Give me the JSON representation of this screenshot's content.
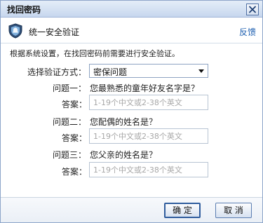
{
  "dialog": {
    "title": "找回密码",
    "close_icon": "close-icon"
  },
  "header": {
    "icon": "shield-icon",
    "title": "统一安全验证",
    "feedback_label": "反馈"
  },
  "description": "根据系统设置，在找回密码前需要进行安全验证。",
  "method": {
    "label": "选择验证方式：",
    "selected": "密保问题"
  },
  "questions": [
    {
      "label": "问题一：",
      "text": "您最熟悉的童年好友名字是？",
      "answer_label": "答案：",
      "placeholder": "1-19个中文或2-38个英文"
    },
    {
      "label": "问题二：",
      "text": "您配偶的姓名是？",
      "answer_label": "答案：",
      "placeholder": "1-19个中文或2-38个英文"
    },
    {
      "label": "问题三：",
      "text": "您父亲的姓名是？",
      "answer_label": "答案：",
      "placeholder": "1-19个中文或2-38个英文"
    }
  ],
  "footer": {
    "ok_label": "确 定",
    "cancel_label": "取 消"
  }
}
